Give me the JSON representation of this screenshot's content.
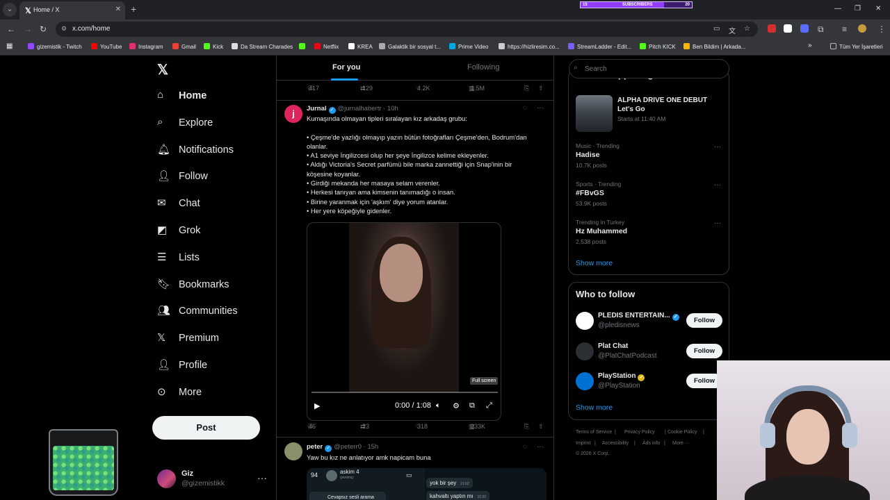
{
  "browser": {
    "tab_title": "Home / X",
    "url": "x.com/home",
    "subs_bar": {
      "left": "15",
      "label": "SUBSCRIBERS",
      "right": "20",
      "progress": 0.75
    },
    "bookmarks": [
      {
        "label": "gizemistik - Twitch",
        "color": "#9146ff"
      },
      {
        "label": "YouTube",
        "color": "#ff0000"
      },
      {
        "label": "Instagram",
        "color": "#e1306c"
      },
      {
        "label": "Gmail",
        "color": "#ea4335"
      },
      {
        "label": "Kick",
        "color": "#53fc18"
      },
      {
        "label": "Da Stream Charades",
        "color": "#dddddd"
      },
      {
        "label": "",
        "color": "#53fc18"
      },
      {
        "label": "Netflix",
        "color": "#e50914"
      },
      {
        "label": "KREA",
        "color": "#ffffff"
      },
      {
        "label": "Galaktik bir sosyal t...",
        "color": "#aaaaaa"
      },
      {
        "label": "Prime Video",
        "color": "#00a8e1"
      },
      {
        "label": "https://hizliresim.co...",
        "color": "#cccccc"
      },
      {
        "label": "StreamLadder - Edit...",
        "color": "#7c5cff"
      },
      {
        "label": "Pitch KICK",
        "color": "#53fc18"
      },
      {
        "label": "Ben Bildim | Arkada...",
        "color": "#ffb300"
      }
    ],
    "all_bookmarks": "Tüm Yer İşaretleri"
  },
  "nav": {
    "items": [
      {
        "label": "Home",
        "icon": "home-icon"
      },
      {
        "label": "Explore",
        "icon": "search-icon"
      },
      {
        "label": "Notifications",
        "icon": "bell-icon"
      },
      {
        "label": "Follow",
        "icon": "person-plus-icon"
      },
      {
        "label": "Chat",
        "icon": "mail-icon"
      },
      {
        "label": "Grok",
        "icon": "grok-icon"
      },
      {
        "label": "Lists",
        "icon": "list-icon"
      },
      {
        "label": "Bookmarks",
        "icon": "bookmark-icon"
      },
      {
        "label": "Communities",
        "icon": "people-icon"
      },
      {
        "label": "Premium",
        "icon": "x-icon"
      },
      {
        "label": "Profile",
        "icon": "person-icon"
      },
      {
        "label": "More",
        "icon": "more-circle-icon"
      }
    ],
    "post_label": "Post",
    "account": {
      "name": "Giz",
      "handle": "@gizemistikk"
    }
  },
  "feed": {
    "tabs": [
      "For you",
      "Following"
    ],
    "prev_actions": {
      "replies": "417",
      "reposts": "129",
      "likes": "4.2K",
      "views": "1.5M"
    },
    "tweet1": {
      "name": "Jurnal",
      "handle": "@jurnalhabertr",
      "time": "10h",
      "lines": [
        "Kumaşında olmayan tipleri sıralayan kız arkadaş grubu:",
        "",
        "• Çeşme'de yazlığı olmayıp yazın bütün fotoğrafları Çeşme'den, Bodrum'dan",
        "olanlar.",
        "• A1 seviye İngilizcesi olup her şeye İngilizce kelime ekleyenler.",
        "• Aldığı Victoria's Secret parfümü bile marka zannettiği için Snap'inin bir",
        "köşesine koyanlar.",
        "• Girdiği mekanda her masaya selam verenler.",
        "• Herkesi tanıyan ama kimsenin tanımadığı o insan.",
        "• Birine yaranmak için 'aşkım' diye yorum atanlar.",
        "• Her yere köpeğiyle gidenler."
      ],
      "video": {
        "time": "0:00 / 1:08",
        "tooltip": "Full screen"
      },
      "actions": {
        "replies": "46",
        "reposts": "23",
        "likes": "318",
        "views": "233K"
      }
    },
    "tweet2": {
      "name": "peter",
      "handle": "@peterr0",
      "time": "15h",
      "text": "Yaw bu kız ne anlatıyor amk napicam buna",
      "chat": {
        "count": "94",
        "contact": "askim 4",
        "status": "çevrimiçi",
        "msg1": "yok bir şey",
        "msg1_time": "21:02",
        "msg2": "kahvaltı yaptın mı",
        "msg2_time": "21:02",
        "missed": "Cevapsız sesli arama"
      }
    }
  },
  "right": {
    "search_placeholder": "Search",
    "section_title_partial": "What's happening",
    "event": {
      "title1": "ALPHA DRIVE ONE DEBUT",
      "title2": "Let's Go",
      "sub": "Starts at 11:40 AM"
    },
    "trends": [
      {
        "meta": "Music · Trending",
        "name": "Hadise",
        "posts": "10.7K posts"
      },
      {
        "meta": "Sports · Trending",
        "name": "#FBvGS",
        "posts": "53.9K posts"
      },
      {
        "meta": "Trending in Turkey",
        "name": "Hz Muhammed",
        "posts": "2,538 posts"
      }
    ],
    "show_more": "Show more",
    "who_to_follow": "Who to follow",
    "suggestions": [
      {
        "name": "PLEDIS ENTERTAIN...",
        "handle": "@pledisnews",
        "badge": "blue",
        "avatar_color": "#ffffff"
      },
      {
        "name": "Plat Chat",
        "handle": "@PlatChatPodcast",
        "badge": "",
        "avatar_color": "#2b2f33"
      },
      {
        "name": "PlayStation",
        "handle": "@PlayStation",
        "badge": "gold",
        "avatar_color": "#0070d1"
      }
    ],
    "follow_label": "Follow",
    "footer": [
      "Terms of Service",
      "|",
      "Privacy Policy",
      "|",
      "Cookie Policy",
      "|",
      "Imprint",
      "|",
      "Accessibility",
      "|",
      "Ads info",
      "|",
      "More ···",
      "© 2026 X Corp."
    ]
  }
}
